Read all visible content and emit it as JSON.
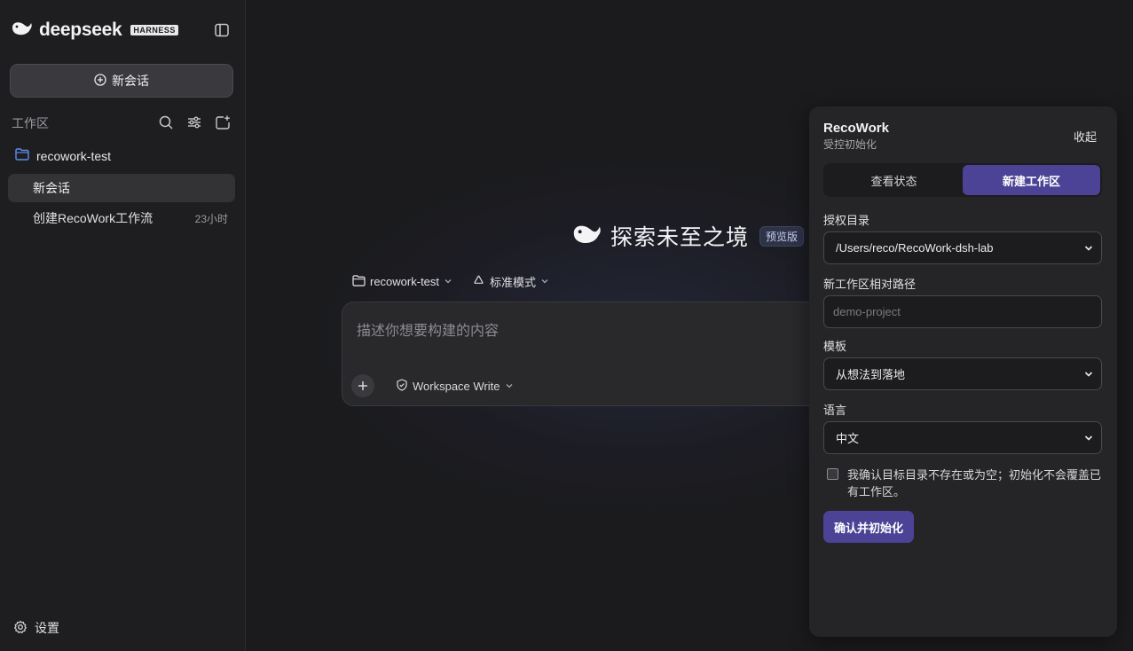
{
  "brand": {
    "name": "deepseek",
    "badge": "HARNESS"
  },
  "sidebar": {
    "new_chat_label": "新会话",
    "workspace_header": "工作区",
    "folder_name": "recowork-test",
    "sessions": [
      {
        "label": "新会话",
        "time": ""
      },
      {
        "label": "创建RecoWork工作流",
        "time": "23小时"
      }
    ],
    "settings_label": "设置"
  },
  "main": {
    "hero_title": "探索未至之境",
    "hero_badge": "预览版",
    "workspace_select": "recowork-test",
    "mode_select": "标准模式",
    "composer_placeholder": "描述你想要构建的内容",
    "permission_label": "Workspace Write"
  },
  "panel": {
    "title": "RecoWork",
    "subtitle": "受控初始化",
    "collapse_label": "收起",
    "tabs": [
      "查看状态",
      "新建工作区"
    ],
    "active_tab": "新建工作区",
    "dir_label": "授权目录",
    "dir_value": "/Users/reco/RecoWork-dsh-lab",
    "path_label": "新工作区相对路径",
    "path_placeholder": "demo-project",
    "template_label": "模板",
    "template_value": "从想法到落地",
    "lang_label": "语言",
    "lang_value": "中文",
    "confirm_text": "我确认目标目录不存在或为空；初始化不会覆盖已有工作区。",
    "confirm_button": "确认并初始化"
  },
  "colors": {
    "accent": "#4d4396",
    "background": "#1b1b1d",
    "sidebar": "#1e1e20",
    "folder_icon": "#5b8def"
  }
}
